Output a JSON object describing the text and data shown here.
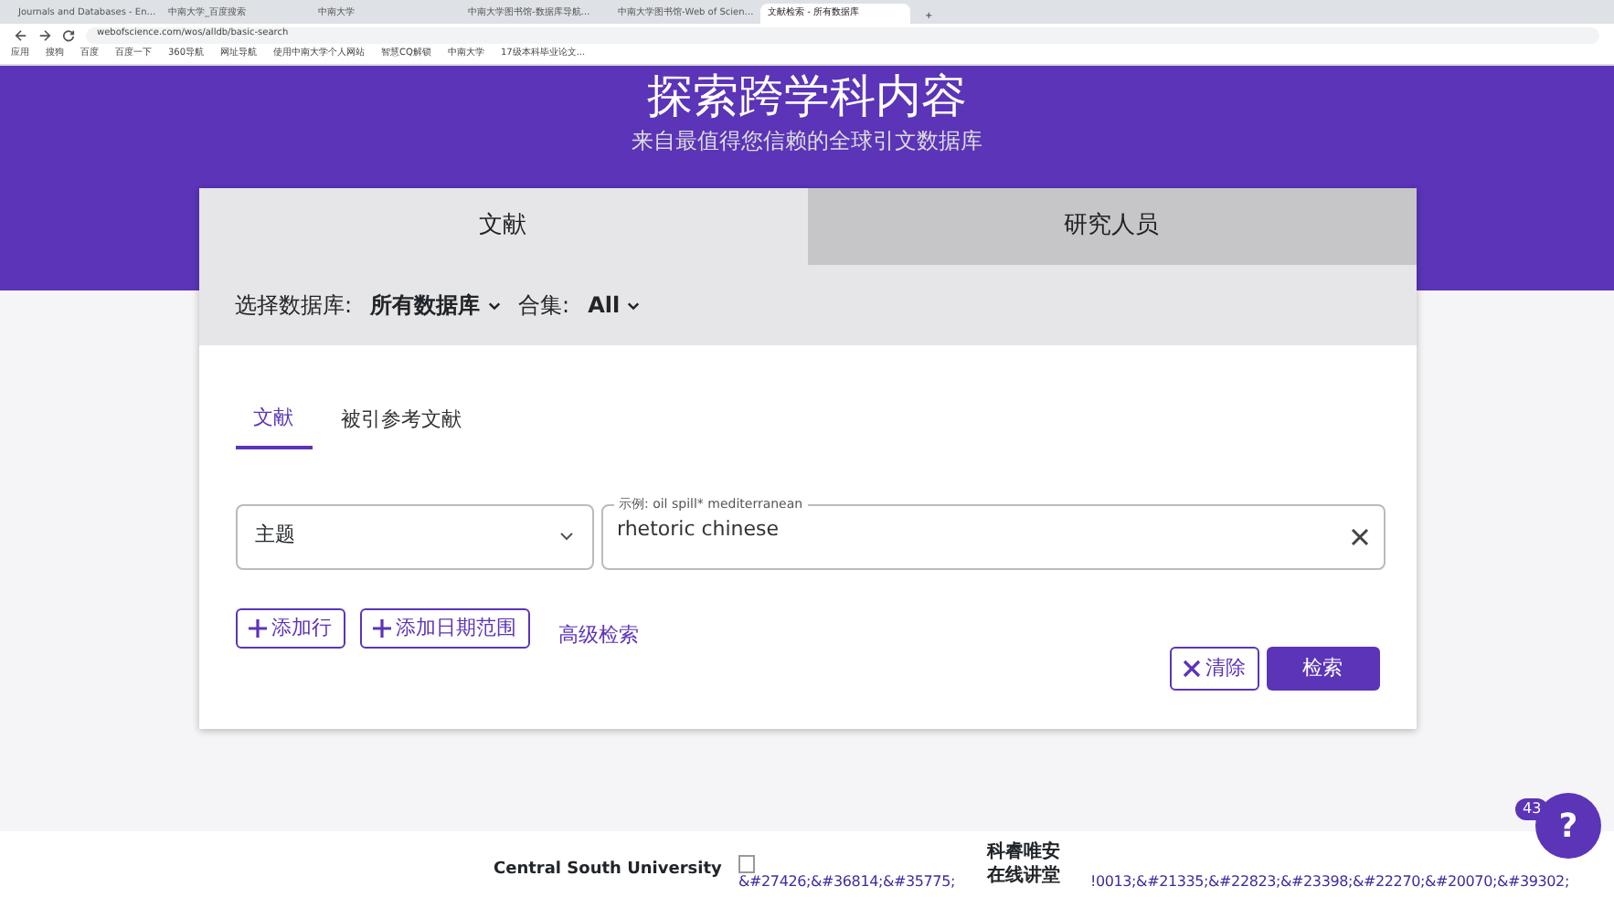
{
  "browser": {
    "tabs": [
      {
        "title": "Journals and Databases - En…",
        "selected": false
      },
      {
        "title": "中南大学_百度搜索",
        "selected": false
      },
      {
        "title": "中南大学",
        "selected": false
      },
      {
        "title": "中南大学图书馆-数据库导航…",
        "selected": false
      },
      {
        "title": "中南大学图书馆-Web of Scien…",
        "selected": false
      },
      {
        "title": "文献检索 - 所有数据库",
        "selected": true
      }
    ],
    "new_tab": "+",
    "url": "webofscience.com/wos/alldb/basic-search",
    "bookmarks": [
      "应用",
      "搜狗",
      "百度",
      "百度一下",
      "360导航",
      "网址导航",
      "使用中南大学个人网站",
      "智慧CQ解锁",
      "中南大学",
      "17级本科毕业论文..."
    ]
  },
  "hero": {
    "title": "探索跨学科内容",
    "subtitle": "来自最值得您信赖的全球引文数据库"
  },
  "search_tabs": [
    {
      "label": "文献",
      "selected": true
    },
    {
      "label": "研究人员",
      "selected": false
    }
  ],
  "database": {
    "label": "选择数据库:",
    "value": "所有数据库",
    "collection_label": "合集:",
    "collection_value": "All"
  },
  "sub_tabs": [
    {
      "label": "文献",
      "selected": true
    },
    {
      "label": "被引参考文献",
      "selected": false
    }
  ],
  "search_row": {
    "field": "主题",
    "placeholder": "示例: oil spill* mediterranean",
    "value": "rhetoric chinese"
  },
  "actions": {
    "add_row": "添加行",
    "add_date": "添加日期范围",
    "advanced": "高级检索",
    "clear": "清除",
    "search": "检索"
  },
  "footer": {
    "university": "Central South University",
    "encoded_left": "&#27426;&#36814;&#35775;",
    "encoded_right": "!0013;&#21335;&#22823;&#23398;&#22270;&#20070;&#39302;",
    "logo_line1": "科睿唯安",
    "logo_line2": "在线讲堂",
    "badge": "43",
    "help": "?"
  }
}
